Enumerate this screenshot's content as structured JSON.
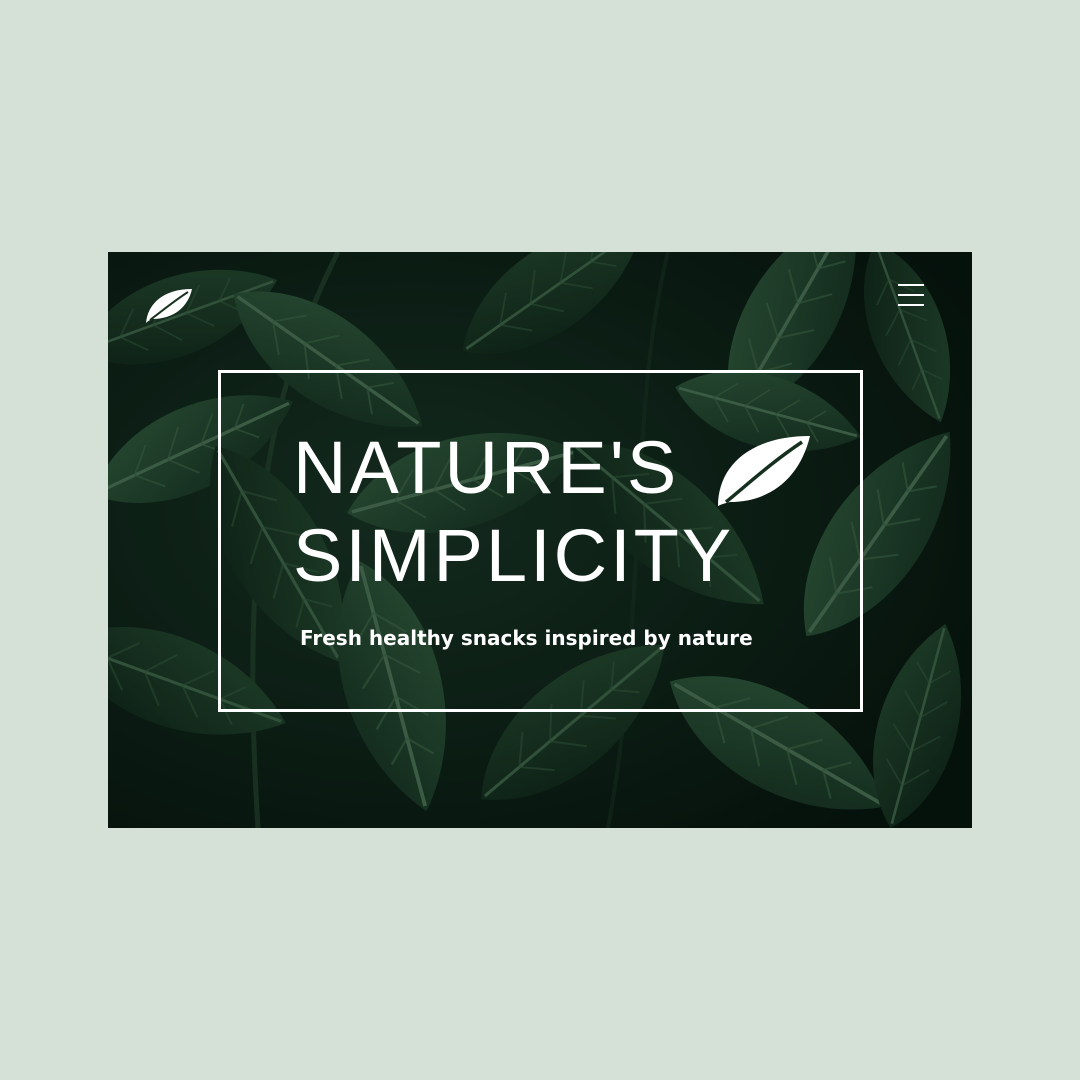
{
  "hero": {
    "title_line1": "NATURE'S",
    "title_line2": "SIMPLICITY",
    "tagline": "Fresh healthy snacks inspired by nature"
  },
  "header": {
    "logo_icon": "leaf-icon",
    "menu_icon": "hamburger-menu-icon"
  },
  "colors": {
    "page_background": "#d5e0d7",
    "foliage_dark": "#0a1a13",
    "foliage_green": "#2e5a3c",
    "text": "#ffffff"
  }
}
